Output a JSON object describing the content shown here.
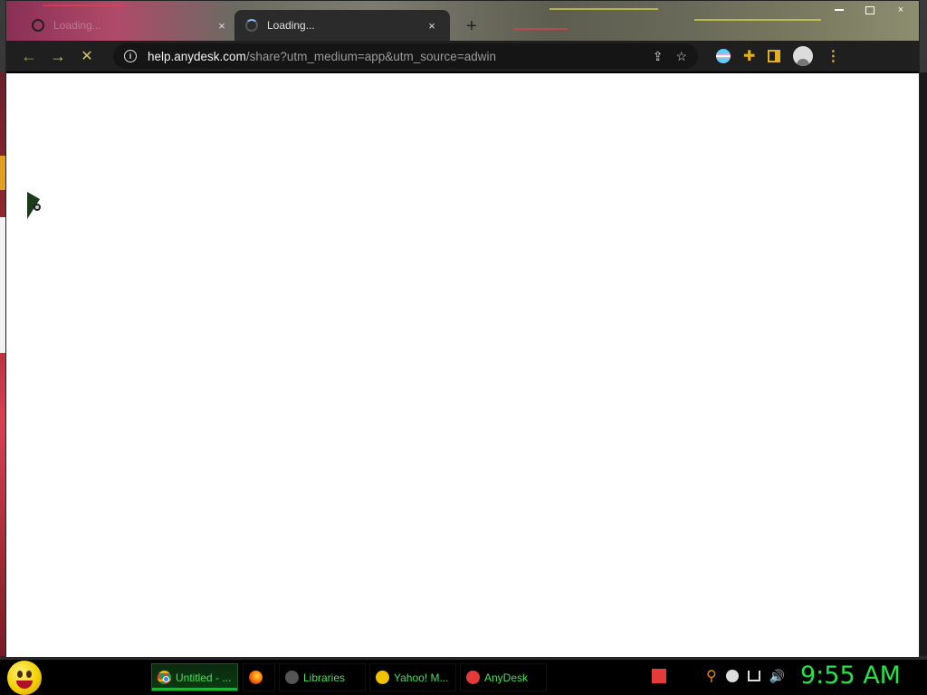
{
  "browser": {
    "tabs": [
      {
        "label": "Loading...",
        "state": "inactive",
        "close": "×"
      },
      {
        "label": "Loading...",
        "state": "active",
        "close": "×"
      }
    ],
    "new_tab": "+",
    "window_controls": {
      "minimize": "minimize-icon",
      "maximize": "maximize-icon",
      "close": "×"
    },
    "nav": {
      "back": "←",
      "forward": "→",
      "stop": "✕"
    },
    "address_bar": {
      "info_icon": "i",
      "host": "help.anydesk.com",
      "path": "/share?utm_medium=app&utm_source=adwin"
    },
    "toolbar_icons": [
      "share-icon",
      "bookmark-star-icon",
      "trans-flag-extension-icon",
      "extensions-puzzle-icon",
      "side-panel-icon",
      "profile-avatar-icon",
      "menu-icon"
    ]
  },
  "taskbar": {
    "start": "start-smiley-icon",
    "items": [
      {
        "label": "Untitled - ...",
        "icon": "chrome-icon",
        "active": true
      },
      {
        "label": "",
        "icon": "firefox-icon",
        "active": false
      },
      {
        "label": "Libraries",
        "icon": "libraries-icon",
        "active": false
      },
      {
        "label": "Yahoo! M...",
        "icon": "yahoo-messenger-icon",
        "active": false
      },
      {
        "label": "AnyDesk",
        "icon": "anydesk-icon",
        "active": false
      }
    ],
    "tray": [
      "anydesk-tray-icon",
      "search-tray-icon",
      "messenger-tray-icon",
      "network-icon",
      "volume-icon"
    ],
    "clock": "9:55 AM"
  },
  "colors": {
    "clock_green": "#28e048",
    "taskbar_label_green": "#46e05a",
    "toolbar_accent": "#e0b020"
  }
}
